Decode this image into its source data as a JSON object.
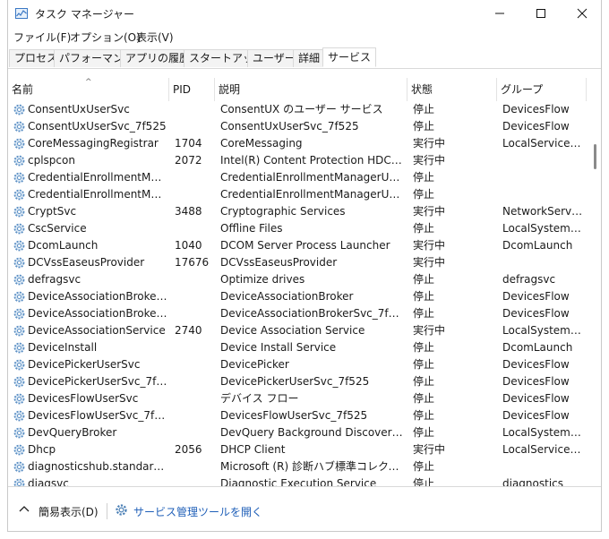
{
  "window": {
    "title": "タスク マネージャー",
    "controls": {
      "minimize": "—",
      "maximize": "☐",
      "close": "✕"
    }
  },
  "menu": [
    {
      "label": "ファイル(F)"
    },
    {
      "label": "オプション(O)"
    },
    {
      "label": "表示(V)"
    }
  ],
  "tabs": [
    {
      "label": "プロセス"
    },
    {
      "label": "パフォーマンス"
    },
    {
      "label": "アプリの履歴"
    },
    {
      "label": "スタートアップ"
    },
    {
      "label": "ユーザー"
    },
    {
      "label": "詳細"
    },
    {
      "label": "サービス",
      "active": true
    }
  ],
  "columns": [
    "名前",
    "PID",
    "説明",
    "状態",
    "グループ"
  ],
  "rows": [
    {
      "name": "ConsentUxUserSvc",
      "pid": "",
      "desc": "ConsentUX のユーザー サービス",
      "status": "停止",
      "group": "DevicesFlow"
    },
    {
      "name": "ConsentUxUserSvc_7f525",
      "pid": "",
      "desc": "ConsentUxUserSvc_7f525",
      "status": "停止",
      "group": "DevicesFlow"
    },
    {
      "name": "CoreMessagingRegistrar",
      "pid": "1704",
      "desc": "CoreMessaging",
      "status": "実行中",
      "group": "LocalServiceN..."
    },
    {
      "name": "cplspcon",
      "pid": "2072",
      "desc": "Intel(R) Content Protection HDCP Se...",
      "status": "実行中",
      "group": ""
    },
    {
      "name": "CredentialEnrollmentMana...",
      "pid": "",
      "desc": "CredentialEnrollmentManagerUserSvc",
      "status": "停止",
      "group": ""
    },
    {
      "name": "CredentialEnrollmentMana...",
      "pid": "",
      "desc": "CredentialEnrollmentManagerUserSv...",
      "status": "停止",
      "group": ""
    },
    {
      "name": "CryptSvc",
      "pid": "3488",
      "desc": "Cryptographic Services",
      "status": "実行中",
      "group": "NetworkService"
    },
    {
      "name": "CscService",
      "pid": "",
      "desc": "Offline Files",
      "status": "停止",
      "group": "LocalSystemN..."
    },
    {
      "name": "DcomLaunch",
      "pid": "1040",
      "desc": "DCOM Server Process Launcher",
      "status": "実行中",
      "group": "DcomLaunch"
    },
    {
      "name": "DCVssEaseusProvider",
      "pid": "17676",
      "desc": "DCVssEaseusProvider",
      "status": "実行中",
      "group": ""
    },
    {
      "name": "defragsvc",
      "pid": "",
      "desc": "Optimize drives",
      "status": "停止",
      "group": "defragsvc"
    },
    {
      "name": "DeviceAssociationBrokerSvc",
      "pid": "",
      "desc": "DeviceAssociationBroker",
      "status": "停止",
      "group": "DevicesFlow"
    },
    {
      "name": "DeviceAssociationBrokerSv...",
      "pid": "",
      "desc": "DeviceAssociationBrokerSvc_7f525",
      "status": "停止",
      "group": "DevicesFlow"
    },
    {
      "name": "DeviceAssociationService",
      "pid": "2740",
      "desc": "Device Association Service",
      "status": "実行中",
      "group": "LocalSystemN..."
    },
    {
      "name": "DeviceInstall",
      "pid": "",
      "desc": "Device Install Service",
      "status": "停止",
      "group": "DcomLaunch"
    },
    {
      "name": "DevicePickerUserSvc",
      "pid": "",
      "desc": "DevicePicker",
      "status": "停止",
      "group": "DevicesFlow"
    },
    {
      "name": "DevicePickerUserSvc_7f525",
      "pid": "",
      "desc": "DevicePickerUserSvc_7f525",
      "status": "停止",
      "group": "DevicesFlow"
    },
    {
      "name": "DevicesFlowUserSvc",
      "pid": "",
      "desc": "デバイス フロー",
      "status": "停止",
      "group": "DevicesFlow"
    },
    {
      "name": "DevicesFlowUserSvc_7f525",
      "pid": "",
      "desc": "DevicesFlowUserSvc_7f525",
      "status": "停止",
      "group": "DevicesFlow"
    },
    {
      "name": "DevQueryBroker",
      "pid": "",
      "desc": "DevQuery Background Discovery Br...",
      "status": "停止",
      "group": "LocalSystemN..."
    },
    {
      "name": "Dhcp",
      "pid": "2056",
      "desc": "DHCP Client",
      "status": "実行中",
      "group": "LocalServiceN..."
    },
    {
      "name": "diagnosticshub.standardco...",
      "pid": "",
      "desc": "Microsoft (R) 診断ハブ標準コレクター ...",
      "status": "停止",
      "group": ""
    },
    {
      "name": "diagsvc",
      "pid": "",
      "desc": "Diagnostic Execution Service",
      "status": "停止",
      "group": "diagnostics"
    }
  ],
  "footer": {
    "toggle_label": "簡易表示(D)",
    "link_label": "サービス管理ツールを開く"
  },
  "colors": {
    "link": "#1f5fb8",
    "gear": "#4a7fb5"
  }
}
